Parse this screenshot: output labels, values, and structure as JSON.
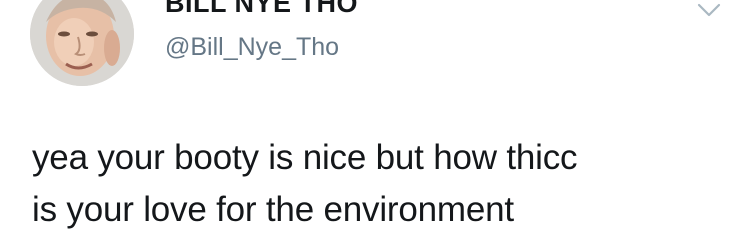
{
  "tweet": {
    "author": {
      "display_name": "BILL NYE THO",
      "handle": "@Bill_Nye_Tho",
      "avatar_icon": "profile-photo"
    },
    "menu_icon": "chevron-down-icon",
    "text_lines": [
      "yea your booty is nice but how thicc",
      "is your love for the environment"
    ]
  },
  "colors": {
    "text_primary": "#14171a",
    "text_secondary": "#657786",
    "caret": "#aab8c2",
    "background": "#ffffff"
  }
}
